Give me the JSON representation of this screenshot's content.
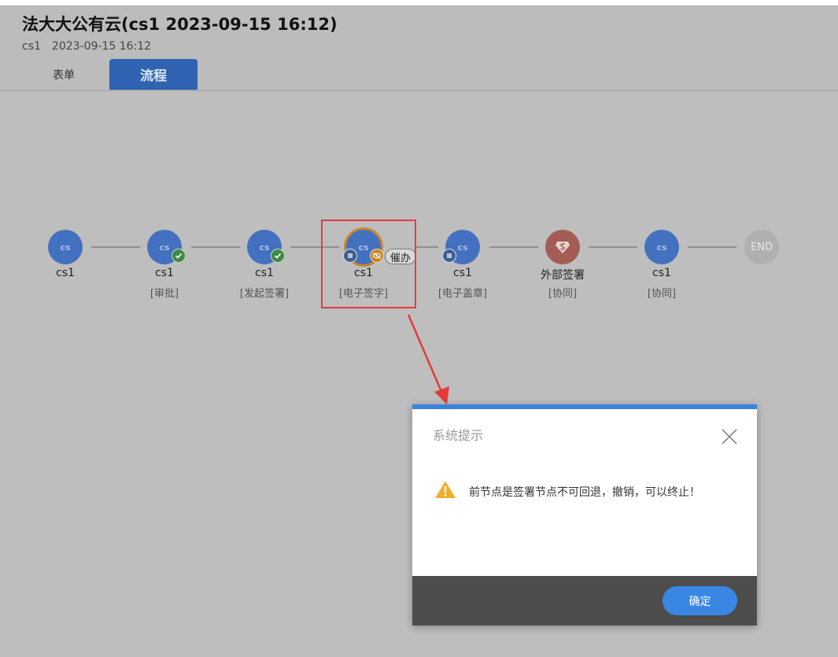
{
  "header": {
    "title": "法大大公有云(cs1 2023-09-15 16:12)",
    "user": "cs1",
    "datetime": "2023-09-15 16:12",
    "tabs": [
      {
        "label": "表单",
        "active": false
      },
      {
        "label": "流程",
        "active": true
      }
    ]
  },
  "flow": {
    "nodes": [
      {
        "avatar": "cs",
        "name": "cs1",
        "type": "",
        "status": "start"
      },
      {
        "avatar": "cs",
        "name": "cs1",
        "type": "[审批]",
        "status": "done",
        "badge_icon": "check-icon"
      },
      {
        "avatar": "cs",
        "name": "cs1",
        "type": "[发起签署]",
        "status": "done",
        "badge_icon": "check-icon"
      },
      {
        "avatar": "cs",
        "name": "cs1",
        "type": "[电子签字]",
        "status": "current",
        "badge_icons": [
          "list-icon",
          "eye-off-icon"
        ]
      },
      {
        "avatar": "cs",
        "name": "cs1",
        "type": "[电子盖章]",
        "status": "pending",
        "badge_icon": "list-icon"
      },
      {
        "avatar": "",
        "name": "外部签署",
        "type": "[协同]",
        "status": "external",
        "icon": "shield-s-icon"
      },
      {
        "avatar": "cs",
        "name": "cs1",
        "type": "[协同]",
        "status": "pending"
      },
      {
        "avatar": "END",
        "name": "",
        "type": "",
        "status": "end"
      }
    ],
    "urge_label": "催办"
  },
  "dialog": {
    "title": "系统提示",
    "message": "前节点是签署节点不可回退，撤销，可以终止！",
    "ok_label": "确定",
    "icon": "warning-icon"
  },
  "colors": {
    "accent": "#3a86e3",
    "node_blue": "#4470c0",
    "done_green": "#3f8a46",
    "current_orange": "#c7862c",
    "highlight_red": "#e63b3b"
  }
}
